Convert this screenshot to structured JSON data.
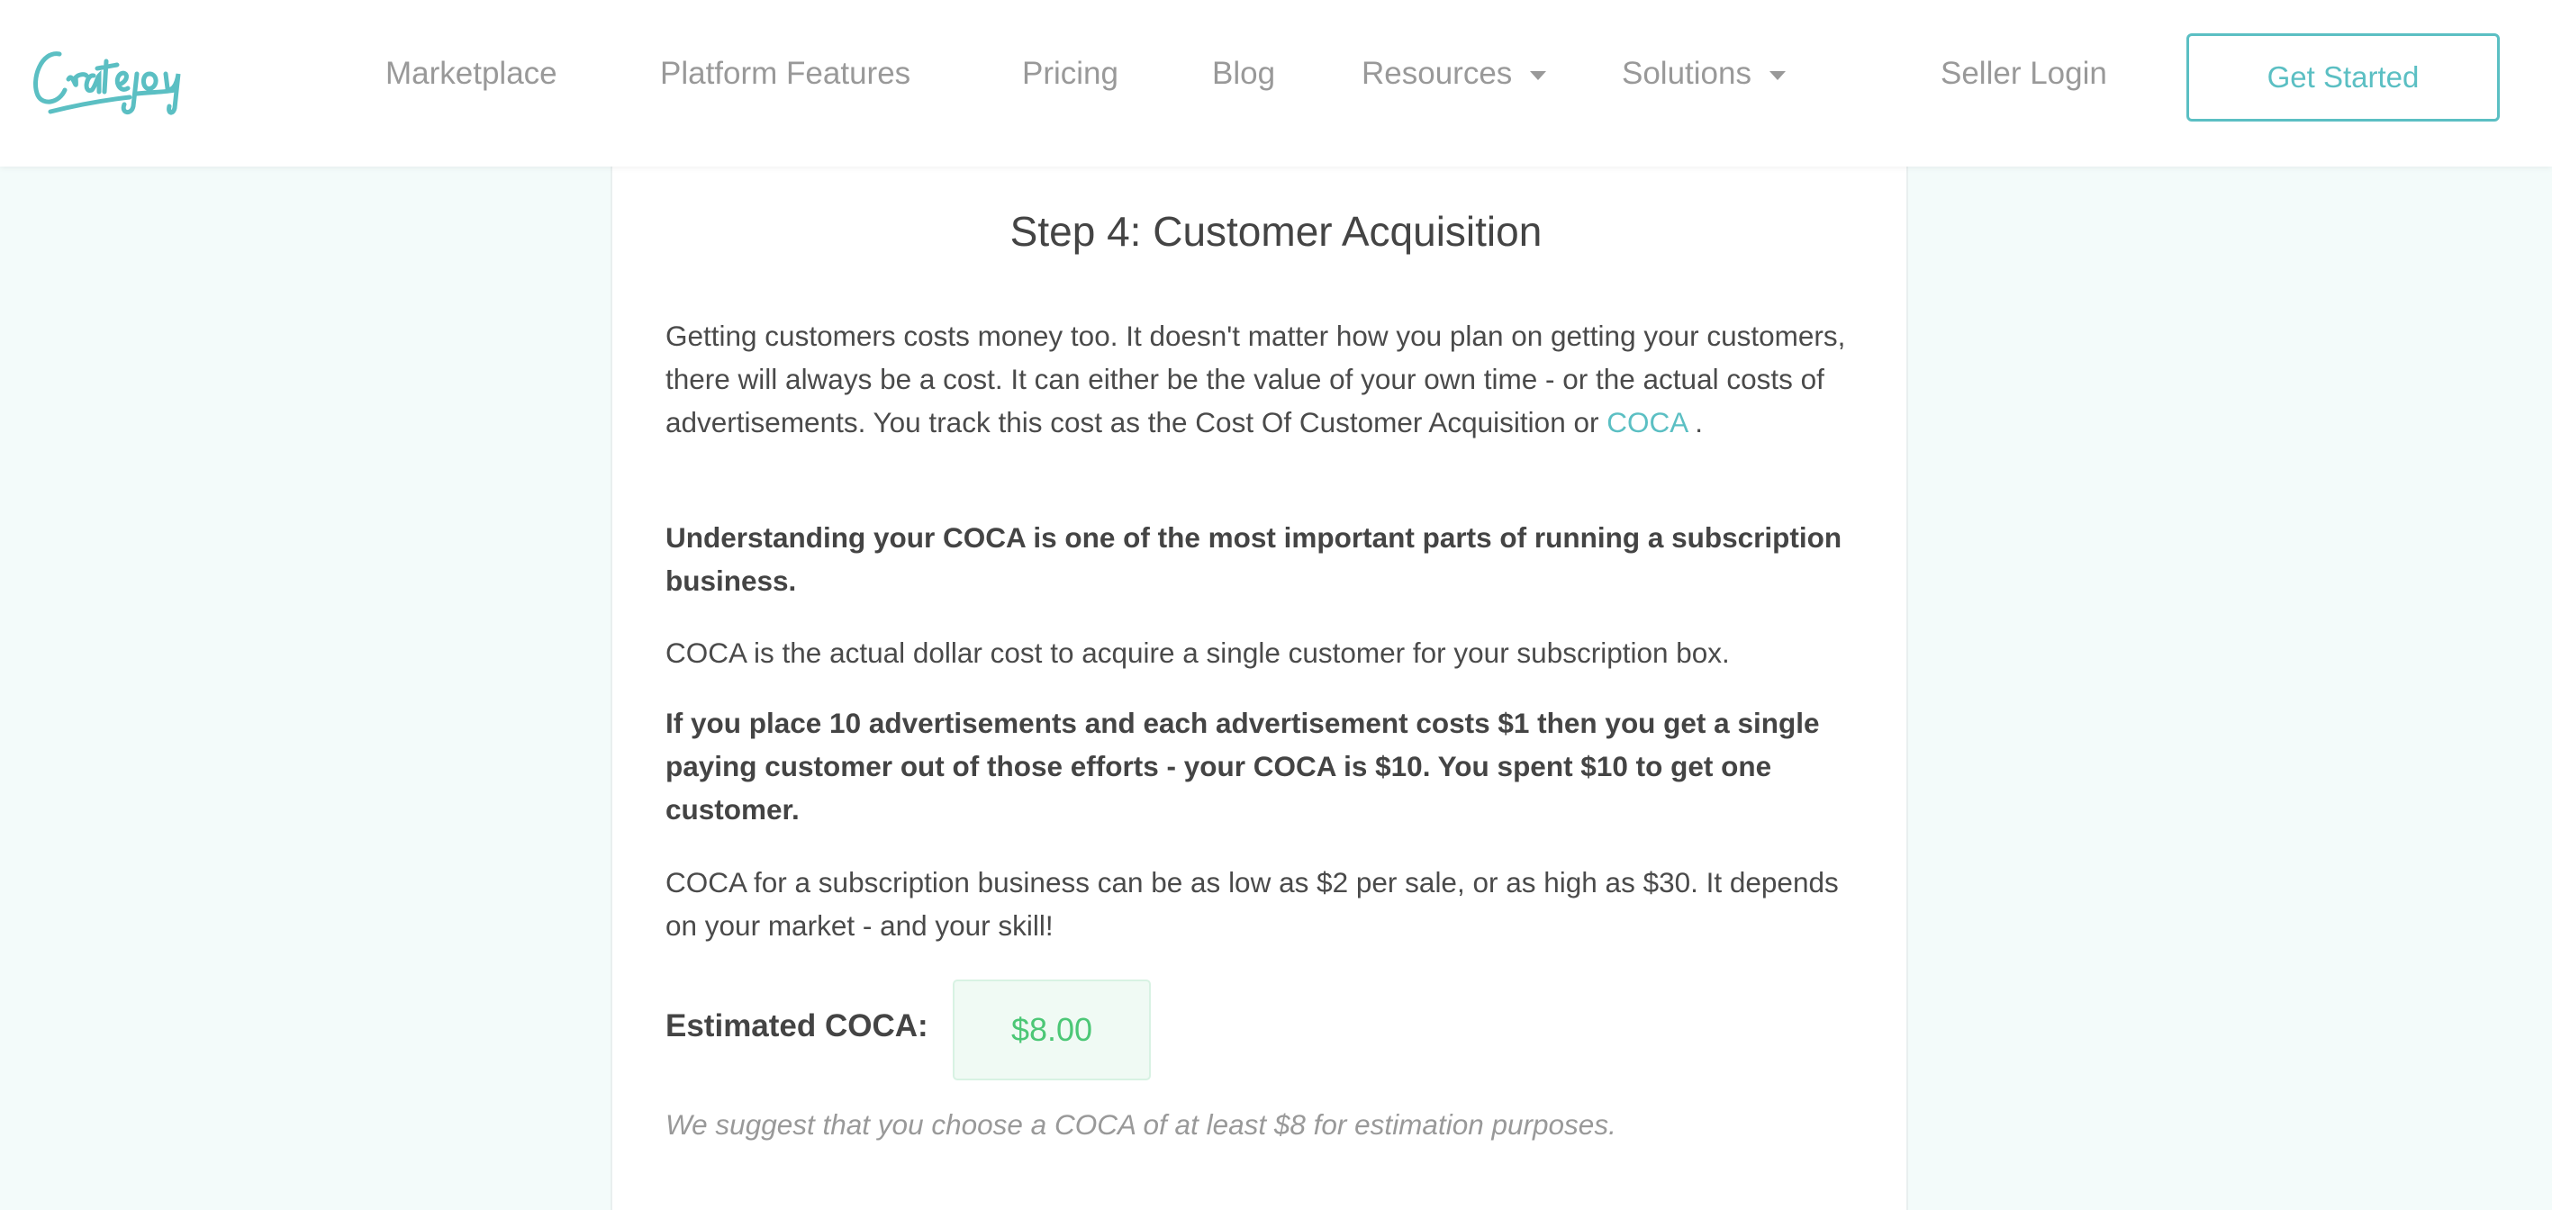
{
  "header": {
    "logo_text": "Cratejoy",
    "nav": [
      "Marketplace",
      "Platform Features",
      "Pricing",
      "Blog",
      "Resources",
      "Solutions"
    ],
    "seller_login": "Seller Login",
    "get_started": "Get Started"
  },
  "content": {
    "title": "Step 4: Customer Acquisition",
    "p1": "Getting customers costs money too. It doesn't matter how you plan on getting your customers, there will always be a cost. It can either be the value of your own time - or the actual costs of advertisements. You track this cost as the Cost Of Customer Acquisition or",
    "p1_link": "COCA",
    "p1_end": " .",
    "p2": "Understanding your COCA is one of the most important parts of running a subscription business.",
    "p3": "COCA is the actual dollar cost to acquire a single customer for your subscription box.",
    "p4": "If you place 10 advertisements and each advertisement costs $1 then you get a single paying customer out of those efforts - your COCA is $10. You spent $10 to get one customer.",
    "p5": "COCA for a subscription business can be as low as $2 per sale, or as high as $30. It depends on your market - and your skill!",
    "estimate_label": "Estimated COCA:",
    "estimate_value": "$8.00",
    "note": "We suggest that you choose a COCA of at least $8 for estimation purposes."
  },
  "colors": {
    "accent": "#5bbfc3",
    "value_green": "#4cc776"
  }
}
